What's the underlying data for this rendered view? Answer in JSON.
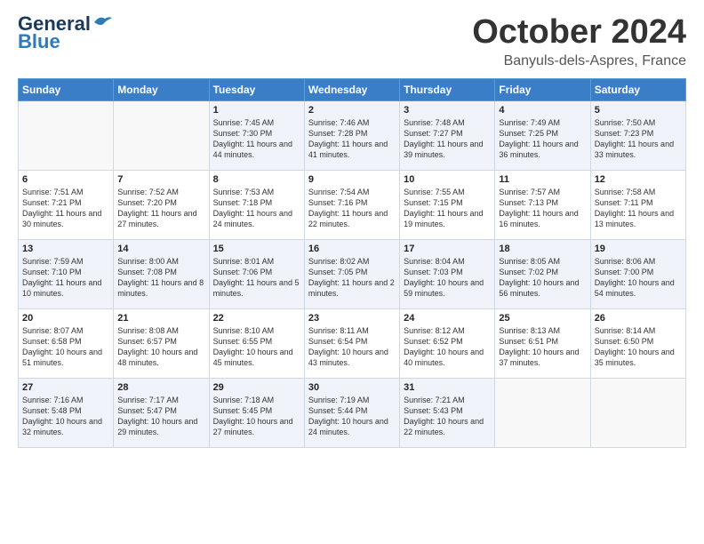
{
  "header": {
    "logo_line1": "General",
    "logo_line2": "Blue",
    "month": "October 2024",
    "location": "Banyuls-dels-Aspres, France"
  },
  "days_of_week": [
    "Sunday",
    "Monday",
    "Tuesday",
    "Wednesday",
    "Thursday",
    "Friday",
    "Saturday"
  ],
  "weeks": [
    [
      {
        "day": "",
        "sunrise": "",
        "sunset": "",
        "daylight": ""
      },
      {
        "day": "",
        "sunrise": "",
        "sunset": "",
        "daylight": ""
      },
      {
        "day": "1",
        "sunrise": "Sunrise: 7:45 AM",
        "sunset": "Sunset: 7:30 PM",
        "daylight": "Daylight: 11 hours and 44 minutes."
      },
      {
        "day": "2",
        "sunrise": "Sunrise: 7:46 AM",
        "sunset": "Sunset: 7:28 PM",
        "daylight": "Daylight: 11 hours and 41 minutes."
      },
      {
        "day": "3",
        "sunrise": "Sunrise: 7:48 AM",
        "sunset": "Sunset: 7:27 PM",
        "daylight": "Daylight: 11 hours and 39 minutes."
      },
      {
        "day": "4",
        "sunrise": "Sunrise: 7:49 AM",
        "sunset": "Sunset: 7:25 PM",
        "daylight": "Daylight: 11 hours and 36 minutes."
      },
      {
        "day": "5",
        "sunrise": "Sunrise: 7:50 AM",
        "sunset": "Sunset: 7:23 PM",
        "daylight": "Daylight: 11 hours and 33 minutes."
      }
    ],
    [
      {
        "day": "6",
        "sunrise": "Sunrise: 7:51 AM",
        "sunset": "Sunset: 7:21 PM",
        "daylight": "Daylight: 11 hours and 30 minutes."
      },
      {
        "day": "7",
        "sunrise": "Sunrise: 7:52 AM",
        "sunset": "Sunset: 7:20 PM",
        "daylight": "Daylight: 11 hours and 27 minutes."
      },
      {
        "day": "8",
        "sunrise": "Sunrise: 7:53 AM",
        "sunset": "Sunset: 7:18 PM",
        "daylight": "Daylight: 11 hours and 24 minutes."
      },
      {
        "day": "9",
        "sunrise": "Sunrise: 7:54 AM",
        "sunset": "Sunset: 7:16 PM",
        "daylight": "Daylight: 11 hours and 22 minutes."
      },
      {
        "day": "10",
        "sunrise": "Sunrise: 7:55 AM",
        "sunset": "Sunset: 7:15 PM",
        "daylight": "Daylight: 11 hours and 19 minutes."
      },
      {
        "day": "11",
        "sunrise": "Sunrise: 7:57 AM",
        "sunset": "Sunset: 7:13 PM",
        "daylight": "Daylight: 11 hours and 16 minutes."
      },
      {
        "day": "12",
        "sunrise": "Sunrise: 7:58 AM",
        "sunset": "Sunset: 7:11 PM",
        "daylight": "Daylight: 11 hours and 13 minutes."
      }
    ],
    [
      {
        "day": "13",
        "sunrise": "Sunrise: 7:59 AM",
        "sunset": "Sunset: 7:10 PM",
        "daylight": "Daylight: 11 hours and 10 minutes."
      },
      {
        "day": "14",
        "sunrise": "Sunrise: 8:00 AM",
        "sunset": "Sunset: 7:08 PM",
        "daylight": "Daylight: 11 hours and 8 minutes."
      },
      {
        "day": "15",
        "sunrise": "Sunrise: 8:01 AM",
        "sunset": "Sunset: 7:06 PM",
        "daylight": "Daylight: 11 hours and 5 minutes."
      },
      {
        "day": "16",
        "sunrise": "Sunrise: 8:02 AM",
        "sunset": "Sunset: 7:05 PM",
        "daylight": "Daylight: 11 hours and 2 minutes."
      },
      {
        "day": "17",
        "sunrise": "Sunrise: 8:04 AM",
        "sunset": "Sunset: 7:03 PM",
        "daylight": "Daylight: 10 hours and 59 minutes."
      },
      {
        "day": "18",
        "sunrise": "Sunrise: 8:05 AM",
        "sunset": "Sunset: 7:02 PM",
        "daylight": "Daylight: 10 hours and 56 minutes."
      },
      {
        "day": "19",
        "sunrise": "Sunrise: 8:06 AM",
        "sunset": "Sunset: 7:00 PM",
        "daylight": "Daylight: 10 hours and 54 minutes."
      }
    ],
    [
      {
        "day": "20",
        "sunrise": "Sunrise: 8:07 AM",
        "sunset": "Sunset: 6:58 PM",
        "daylight": "Daylight: 10 hours and 51 minutes."
      },
      {
        "day": "21",
        "sunrise": "Sunrise: 8:08 AM",
        "sunset": "Sunset: 6:57 PM",
        "daylight": "Daylight: 10 hours and 48 minutes."
      },
      {
        "day": "22",
        "sunrise": "Sunrise: 8:10 AM",
        "sunset": "Sunset: 6:55 PM",
        "daylight": "Daylight: 10 hours and 45 minutes."
      },
      {
        "day": "23",
        "sunrise": "Sunrise: 8:11 AM",
        "sunset": "Sunset: 6:54 PM",
        "daylight": "Daylight: 10 hours and 43 minutes."
      },
      {
        "day": "24",
        "sunrise": "Sunrise: 8:12 AM",
        "sunset": "Sunset: 6:52 PM",
        "daylight": "Daylight: 10 hours and 40 minutes."
      },
      {
        "day": "25",
        "sunrise": "Sunrise: 8:13 AM",
        "sunset": "Sunset: 6:51 PM",
        "daylight": "Daylight: 10 hours and 37 minutes."
      },
      {
        "day": "26",
        "sunrise": "Sunrise: 8:14 AM",
        "sunset": "Sunset: 6:50 PM",
        "daylight": "Daylight: 10 hours and 35 minutes."
      }
    ],
    [
      {
        "day": "27",
        "sunrise": "Sunrise: 7:16 AM",
        "sunset": "Sunset: 5:48 PM",
        "daylight": "Daylight: 10 hours and 32 minutes."
      },
      {
        "day": "28",
        "sunrise": "Sunrise: 7:17 AM",
        "sunset": "Sunset: 5:47 PM",
        "daylight": "Daylight: 10 hours and 29 minutes."
      },
      {
        "day": "29",
        "sunrise": "Sunrise: 7:18 AM",
        "sunset": "Sunset: 5:45 PM",
        "daylight": "Daylight: 10 hours and 27 minutes."
      },
      {
        "day": "30",
        "sunrise": "Sunrise: 7:19 AM",
        "sunset": "Sunset: 5:44 PM",
        "daylight": "Daylight: 10 hours and 24 minutes."
      },
      {
        "day": "31",
        "sunrise": "Sunrise: 7:21 AM",
        "sunset": "Sunset: 5:43 PM",
        "daylight": "Daylight: 10 hours and 22 minutes."
      },
      {
        "day": "",
        "sunrise": "",
        "sunset": "",
        "daylight": ""
      },
      {
        "day": "",
        "sunrise": "",
        "sunset": "",
        "daylight": ""
      }
    ]
  ]
}
